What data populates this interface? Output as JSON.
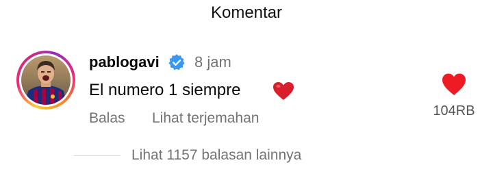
{
  "header": {
    "title": "Komentar"
  },
  "comment": {
    "username": "pablogavi",
    "time": "8 jam",
    "text": "El numero 1 siempre",
    "text_emoji_icon": "red-heart-icon",
    "reply_label": "Balas",
    "translate_label": "Lihat terjemahan",
    "like_count": "104RB",
    "view_replies_label": "Lihat 1157 balasan lainnya"
  },
  "colors": {
    "verified_blue": "#3897f0",
    "heart_red": "#ed1c24",
    "muted_text": "#737373"
  }
}
